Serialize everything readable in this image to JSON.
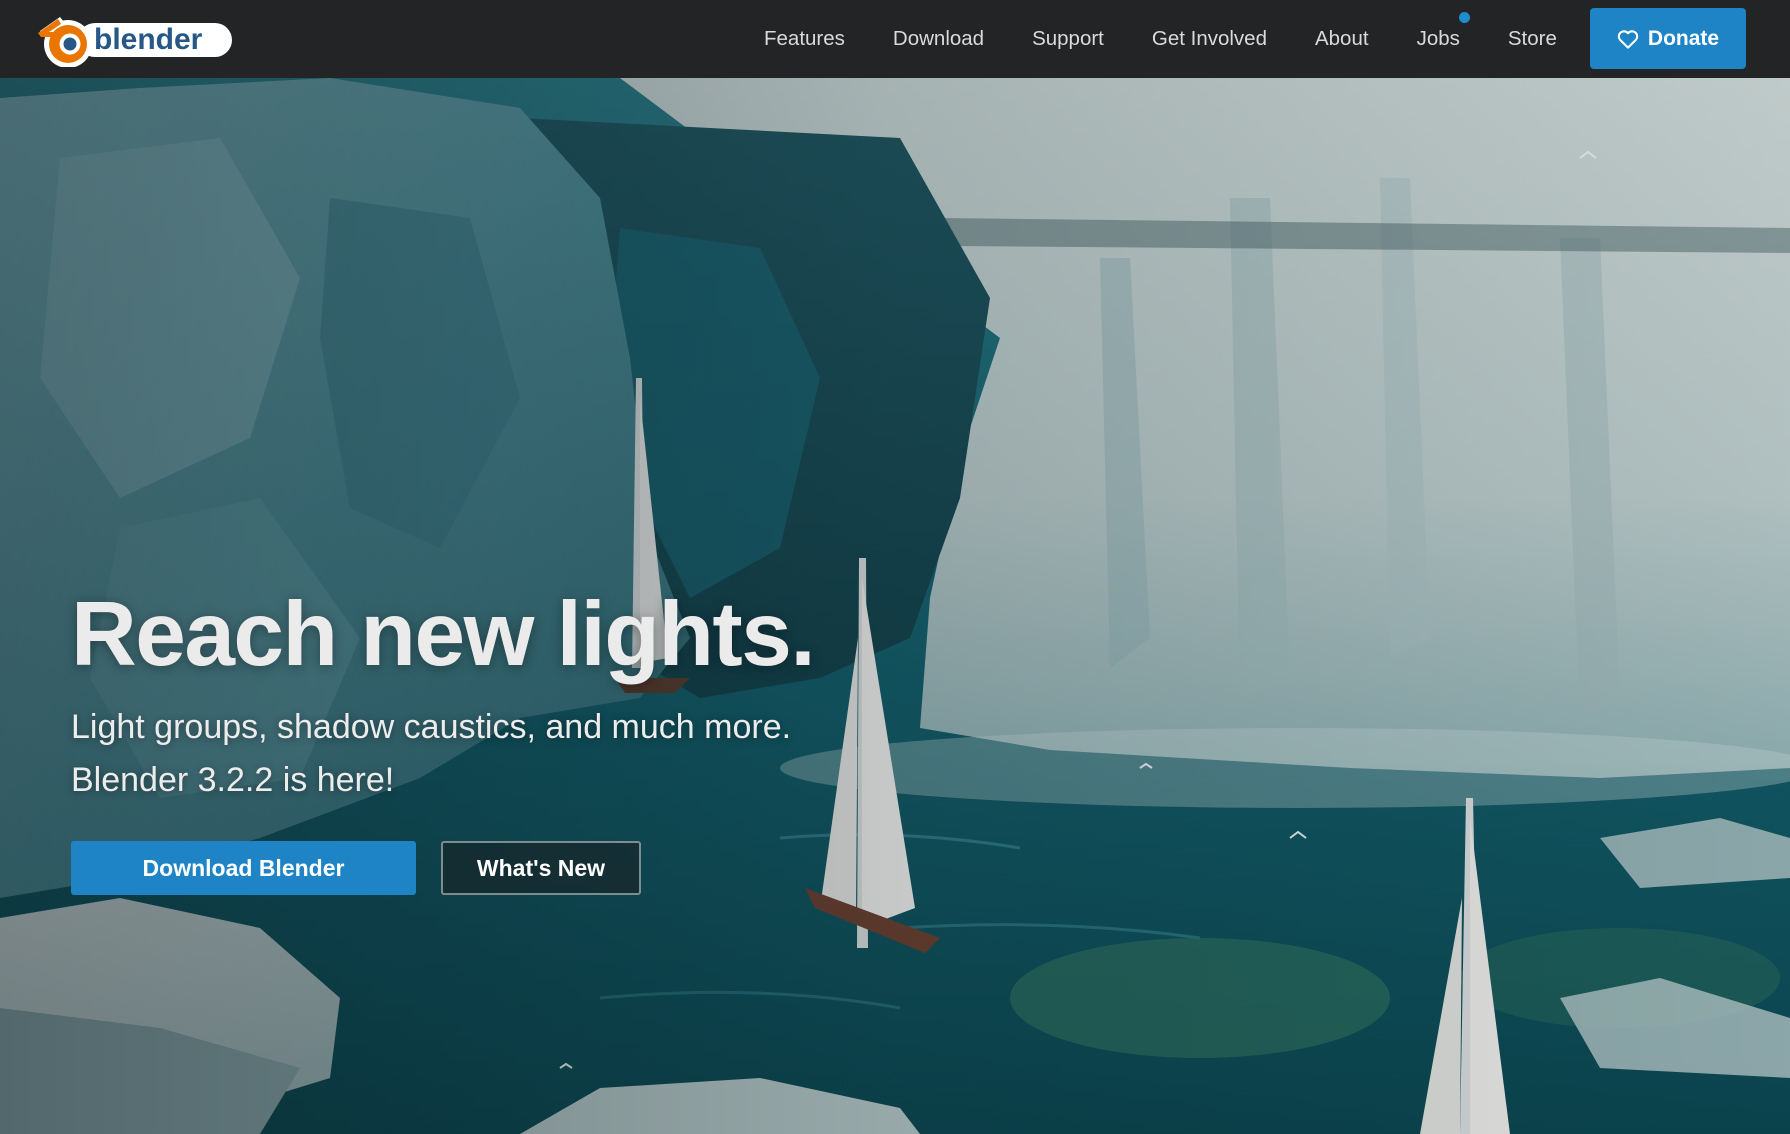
{
  "brand": {
    "logo_text": "blender"
  },
  "nav": {
    "items": [
      {
        "label": "Features"
      },
      {
        "label": "Download"
      },
      {
        "label": "Support"
      },
      {
        "label": "Get Involved"
      },
      {
        "label": "About"
      },
      {
        "label": "Jobs",
        "has_notification_dot": true
      },
      {
        "label": "Store"
      }
    ],
    "donate_label": "Donate",
    "donate_icon": "heart-icon"
  },
  "hero": {
    "title": "Reach new lights.",
    "subtitle_line1": "Light groups, shadow caustics, and much more.",
    "subtitle_line2": "Blender 3.2.2 is here!",
    "primary_button": "Download Blender",
    "secondary_button": "What's New"
  },
  "colors": {
    "navbar_bg": "#232425",
    "accent_blue": "#1e84c5",
    "logo_orange": "#ea7600",
    "logo_blue": "#265787",
    "nav_text": "#d9dadb"
  }
}
